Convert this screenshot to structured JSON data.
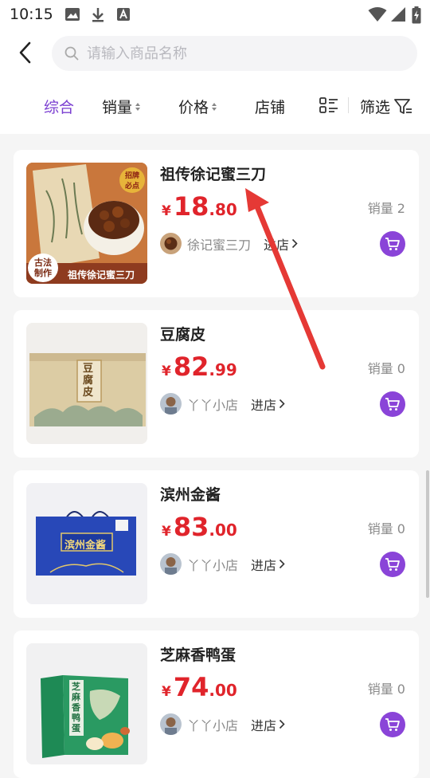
{
  "status_bar": {
    "time": "10:15",
    "left_icons": [
      "image-icon",
      "download-icon",
      "font-a-icon"
    ],
    "right_icons": [
      "wifi-icon",
      "signal-icon",
      "battery-charging-icon"
    ]
  },
  "header": {
    "back_icon": "chevron-left-icon",
    "search": {
      "placeholder": "请输入商品名称",
      "value": ""
    }
  },
  "sort_bar": {
    "items": [
      {
        "label": "综合",
        "active": true
      },
      {
        "label": "销量",
        "sortable": true
      },
      {
        "label": "价格",
        "sortable": true
      },
      {
        "label": "店铺"
      }
    ],
    "grid_toggle_icon": "grid-list-icon",
    "filter": {
      "label": "筛选",
      "icon": "funnel-icon"
    }
  },
  "products": [
    {
      "title": "祖传徐记蜜三刀",
      "price_symbol": "¥",
      "price_int": "18",
      "price_dec": ".80",
      "sales": "销量 2",
      "shop_name": "徐记蜜三刀",
      "enter_label": "进店",
      "image_text": {
        "badge_left_1": "古法",
        "badge_left_2": "制作",
        "bottom": "祖传徐记蜜三刀",
        "seal_1": "招牌",
        "seal_2": "必点"
      }
    },
    {
      "title": "豆腐皮",
      "price_symbol": "¥",
      "price_int": "82",
      "price_dec": ".99",
      "sales": "销量 0",
      "shop_name": "丫丫小店",
      "enter_label": "进店",
      "image_text": {
        "box": "豆腐皮"
      }
    },
    {
      "title": "滨州金酱",
      "price_symbol": "¥",
      "price_int": "83",
      "price_dec": ".00",
      "sales": "销量 0",
      "shop_name": "丫丫小店",
      "enter_label": "进店",
      "image_text": {
        "box": "滨州金酱"
      }
    },
    {
      "title": "芝麻香鸭蛋",
      "price_symbol": "¥",
      "price_int": "74",
      "price_dec": ".00",
      "sales": "销量 0",
      "shop_name": "丫丫小店",
      "enter_label": "进店",
      "image_text": {
        "box": "芝麻香鸭蛋"
      }
    }
  ],
  "colors": {
    "accent": "#7b3fd1",
    "price": "#e0242b",
    "cart_button": "#8a44d8",
    "annotation_arrow": "#e53935"
  }
}
